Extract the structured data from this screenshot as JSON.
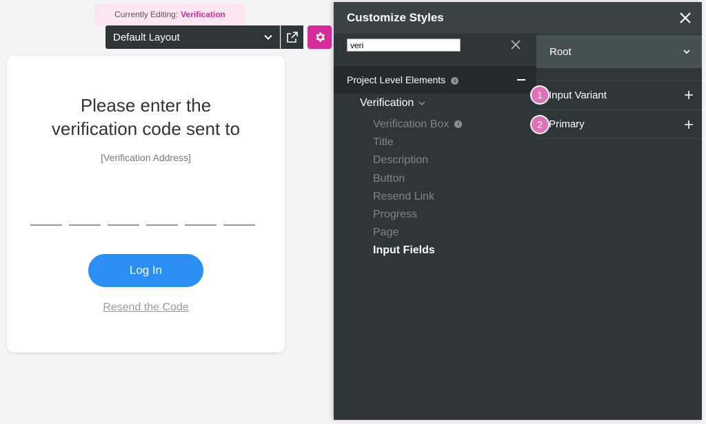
{
  "banner": {
    "prefix": "Currently Editing:",
    "value": "Verification"
  },
  "layout": {
    "selected": "Default Layout"
  },
  "card": {
    "title_line1": "Please enter the",
    "title_line2": "verification code sent to",
    "address": "[Verification Address]",
    "code_slots": 6,
    "login_label": "Log In",
    "resend_label": "Resend the Code"
  },
  "panel": {
    "title": "Customize Styles",
    "search_value": "veri",
    "root_label": "Root",
    "group_label": "Project Level Elements",
    "info_glyph": "i",
    "parent_label": "Verification",
    "children": [
      {
        "label": "Verification Box",
        "info": true,
        "active": false
      },
      {
        "label": "Title",
        "active": false
      },
      {
        "label": "Description",
        "active": false
      },
      {
        "label": "Button",
        "active": false
      },
      {
        "label": "Resend Link",
        "active": false
      },
      {
        "label": "Progress",
        "active": false
      },
      {
        "label": "Page",
        "active": false
      },
      {
        "label": "Input Fields",
        "active": true
      }
    ],
    "variants": [
      {
        "badge": "1",
        "label": "Input Variant"
      },
      {
        "badge": "2",
        "label": "Primary"
      }
    ]
  },
  "colors": {
    "accent": "#d62c98",
    "button": "#2b8ef5",
    "panel_bg": "#2f3638"
  }
}
